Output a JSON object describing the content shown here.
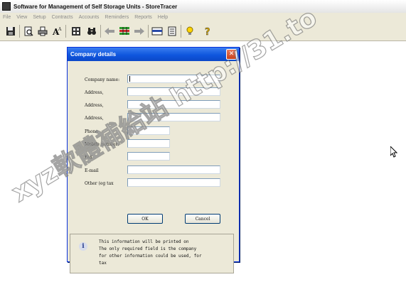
{
  "window": {
    "title": "Software for Management of Self Storage Units - StoreTracer"
  },
  "menu": [
    "File",
    "View",
    "Setup",
    "Contracts",
    "Accounts",
    "Reminders",
    "Reports",
    "Help"
  ],
  "toolbar": {
    "icons": [
      "save-icon",
      "print-preview-icon",
      "print-icon",
      "font-icon",
      "calculator-icon",
      "binoculars-icon",
      "arrow-left-icon",
      "grid-icon",
      "arrow-right-icon",
      "card-icon",
      "document-icon",
      "lightbulb-icon",
      "help-icon"
    ]
  },
  "dialog": {
    "title": "Company details",
    "close_glyph": "✕",
    "fields": [
      {
        "label": "Company name:",
        "value": ""
      },
      {
        "label": "Address,",
        "value": ""
      },
      {
        "label": "Address,",
        "value": ""
      },
      {
        "label": "Address,",
        "value": ""
      },
      {
        "label": "Phone",
        "value": ""
      },
      {
        "label": "Mobile number:",
        "value": ""
      },
      {
        "label": "Fax",
        "value": ""
      },
      {
        "label": "E-mail",
        "value": ""
      },
      {
        "label": "Other (eg tax",
        "value": ""
      }
    ],
    "ok_label": "OK",
    "cancel_label": "Cancel",
    "info_glyph": "i",
    "info_text": "This information will be printed on\nThe only required field is the company\nfor other information could be used, for\ntax"
  },
  "watermark": "xyz軟體補給站 http://31.to"
}
